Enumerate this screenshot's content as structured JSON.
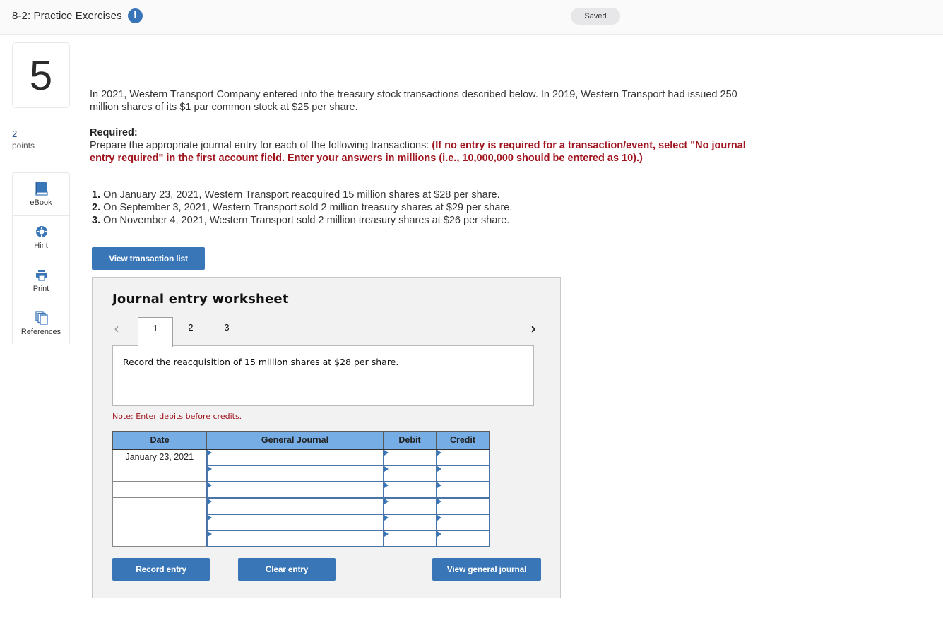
{
  "header": {
    "title": "8-2: Practice Exercises",
    "info_icon": "info-icon",
    "status": "Saved"
  },
  "question": {
    "number": "5",
    "points_value": "2",
    "points_label": "points"
  },
  "tools": [
    {
      "label": "eBook",
      "icon": "book-icon"
    },
    {
      "label": "Hint",
      "icon": "lifebuoy-icon"
    },
    {
      "label": "Print",
      "icon": "printer-icon"
    },
    {
      "label": "References",
      "icon": "documents-icon"
    }
  ],
  "colors": {
    "accent": "#3876b8",
    "warning_red": "#a0141e",
    "table_header": "#76ade4",
    "worksheet_bg": "#f2f2f2"
  },
  "body": {
    "intro": "In 2021, Western Transport Company entered into the treasury stock transactions described below. In 2019, Western Transport had issued 250 million shares of its $1 par common stock at $25 per share.",
    "required_label": "Required:",
    "required_text": "Prepare the appropriate journal entry for each of the following transactions: ",
    "required_red": "(If no entry is required for a transaction/event, select \"No journal entry required\" in the first account field. Enter your answers in millions (i.e., 10,000,000 should be entered as 10).)",
    "transactions": [
      {
        "num": "1.",
        "text": "On January 23, 2021, Western Transport reacquired 15 million shares at $28 per share."
      },
      {
        "num": "2.",
        "text": "On September 3, 2021, Western Transport sold 2 million treasury shares at $29 per share."
      },
      {
        "num": "3.",
        "text": "On November 4, 2021, Western Transport sold 2 million treasury shares at $26 per share."
      }
    ],
    "view_transaction_list": "View transaction list"
  },
  "worksheet": {
    "title": "Journal entry worksheet",
    "prev_glyph": "‹",
    "next_glyph": "›",
    "tabs": [
      "1",
      "2",
      "3"
    ],
    "active_tab": "1",
    "prompt": "Record the reacquisition of 15 million shares at $28 per share.",
    "note": "Note: Enter debits before credits.",
    "columns": [
      "Date",
      "General Journal",
      "Debit",
      "Credit"
    ],
    "rows": [
      {
        "date": "January 23, 2021",
        "account": "",
        "debit": "",
        "credit": ""
      },
      {
        "date": "",
        "account": "",
        "debit": "",
        "credit": ""
      },
      {
        "date": "",
        "account": "",
        "debit": "",
        "credit": ""
      },
      {
        "date": "",
        "account": "",
        "debit": "",
        "credit": ""
      },
      {
        "date": "",
        "account": "",
        "debit": "",
        "credit": ""
      },
      {
        "date": "",
        "account": "",
        "debit": "",
        "credit": ""
      }
    ],
    "buttons": {
      "record": "Record entry",
      "clear": "Clear entry",
      "view_general_journal": "View general journal"
    }
  }
}
